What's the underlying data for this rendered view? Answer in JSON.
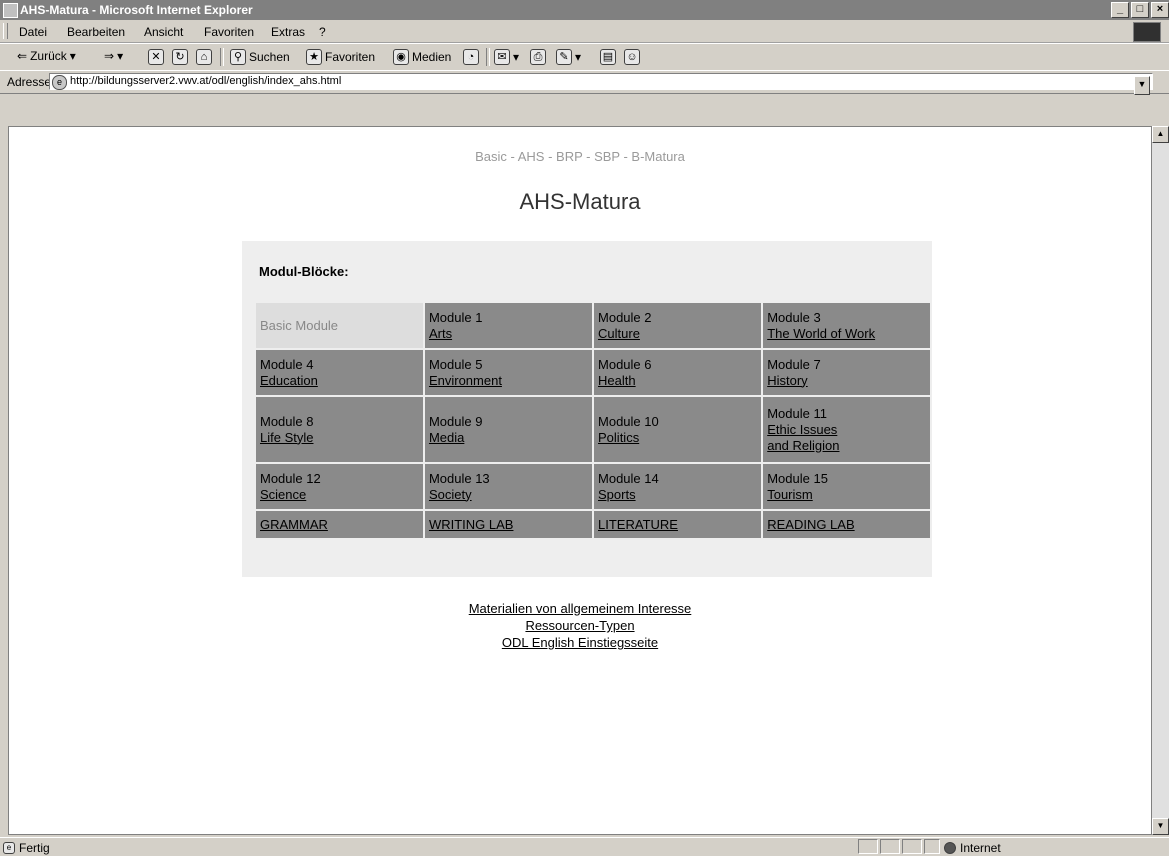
{
  "window": {
    "title": "AHS-Matura - Microsoft Internet Explorer"
  },
  "menu": [
    {
      "label": "Datei",
      "key": "D"
    },
    {
      "label": "Bearbeiten",
      "key": "B"
    },
    {
      "label": "Ansicht",
      "key": "A"
    },
    {
      "label": "Favoriten",
      "key": "F"
    },
    {
      "label": "Extras",
      "key": "x"
    },
    {
      "label": "?",
      "key": "?"
    }
  ],
  "toolbar": {
    "back": "Zurück",
    "search": "Suchen",
    "favorites": "Favoriten",
    "media": "Medien"
  },
  "address": {
    "label": "Adresse",
    "url": "http://bildungsserver2.vwv.at/odl/english/index_ahs.html"
  },
  "page": {
    "breadcrumb": "Basic - AHS - BRP - SBP - B-Matura",
    "title": "AHS-Matura",
    "panel_heading": "Modul-Blöcke:",
    "grid": [
      [
        {
          "heading": "Basic Module",
          "links": [],
          "muted": true
        },
        {
          "heading": "Module 1",
          "links": [
            "Arts"
          ]
        },
        {
          "heading": "Module 2",
          "links": [
            "Culture"
          ]
        },
        {
          "heading": "Module 3",
          "links": [
            "The World of Work"
          ]
        }
      ],
      [
        {
          "heading": "Module 4",
          "links": [
            "Education"
          ]
        },
        {
          "heading": "Module 5",
          "links": [
            "Environment"
          ]
        },
        {
          "heading": "Module 6",
          "links": [
            "Health"
          ]
        },
        {
          "heading": "Module 7",
          "links": [
            "History"
          ]
        }
      ],
      [
        {
          "heading": "Module 8",
          "links": [
            "Life Style"
          ]
        },
        {
          "heading": "Module 9",
          "links": [
            "Media"
          ]
        },
        {
          "heading": "Module 10",
          "links": [
            "Politics"
          ]
        },
        {
          "heading": "Module 11",
          "links": [
            "Ethic Issues",
            "and Religion"
          ]
        }
      ],
      [
        {
          "heading": "Module 12",
          "links": [
            "Science"
          ]
        },
        {
          "heading": "Module 13",
          "links": [
            "Society"
          ]
        },
        {
          "heading": "Module 14",
          "links": [
            "Sports"
          ]
        },
        {
          "heading": "Module 15",
          "links": [
            "Tourism"
          ]
        }
      ],
      [
        {
          "heading": "",
          "links": [
            "GRAMMAR"
          ]
        },
        {
          "heading": "",
          "links": [
            "WRITING LAB"
          ]
        },
        {
          "heading": "",
          "links": [
            "LITERATURE"
          ]
        },
        {
          "heading": "",
          "links": [
            "READING LAB"
          ]
        }
      ]
    ],
    "footer_links": [
      "Materialien von allgemeinem Interesse",
      "Ressourcen-Typen",
      "ODL English Einstiegsseite"
    ]
  },
  "status": {
    "text": "Fertig",
    "zone": "Internet"
  }
}
